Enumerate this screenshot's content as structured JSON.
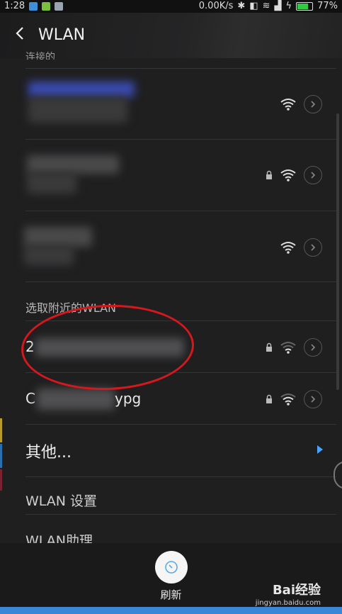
{
  "status_bar": {
    "time": "1:28",
    "speed": "0.00K/s",
    "battery": "77%",
    "battery_level": 0.77
  },
  "header": {
    "title": "WLAN"
  },
  "sections": {
    "connected_label_cut": "连接的",
    "nearby_label": "选取附近的WLAN"
  },
  "nearby_networks": [
    {
      "name_prefix": "2",
      "name_suffix": ""
    },
    {
      "name_prefix": "C",
      "name_suffix": "ypg"
    }
  ],
  "other": {
    "label": "其他..."
  },
  "menu": {
    "wlan_settings": "WLAN 设置",
    "wlan_assistant": "WLAN助理"
  },
  "bottom": {
    "refresh_label": "刷新"
  },
  "watermark": {
    "main": "Bai经验",
    "sub": "jingyan.baidu.com"
  },
  "colors": {
    "accent": "#4aa3ff",
    "annotation": "#d5181d",
    "background": "#1f1f20"
  }
}
